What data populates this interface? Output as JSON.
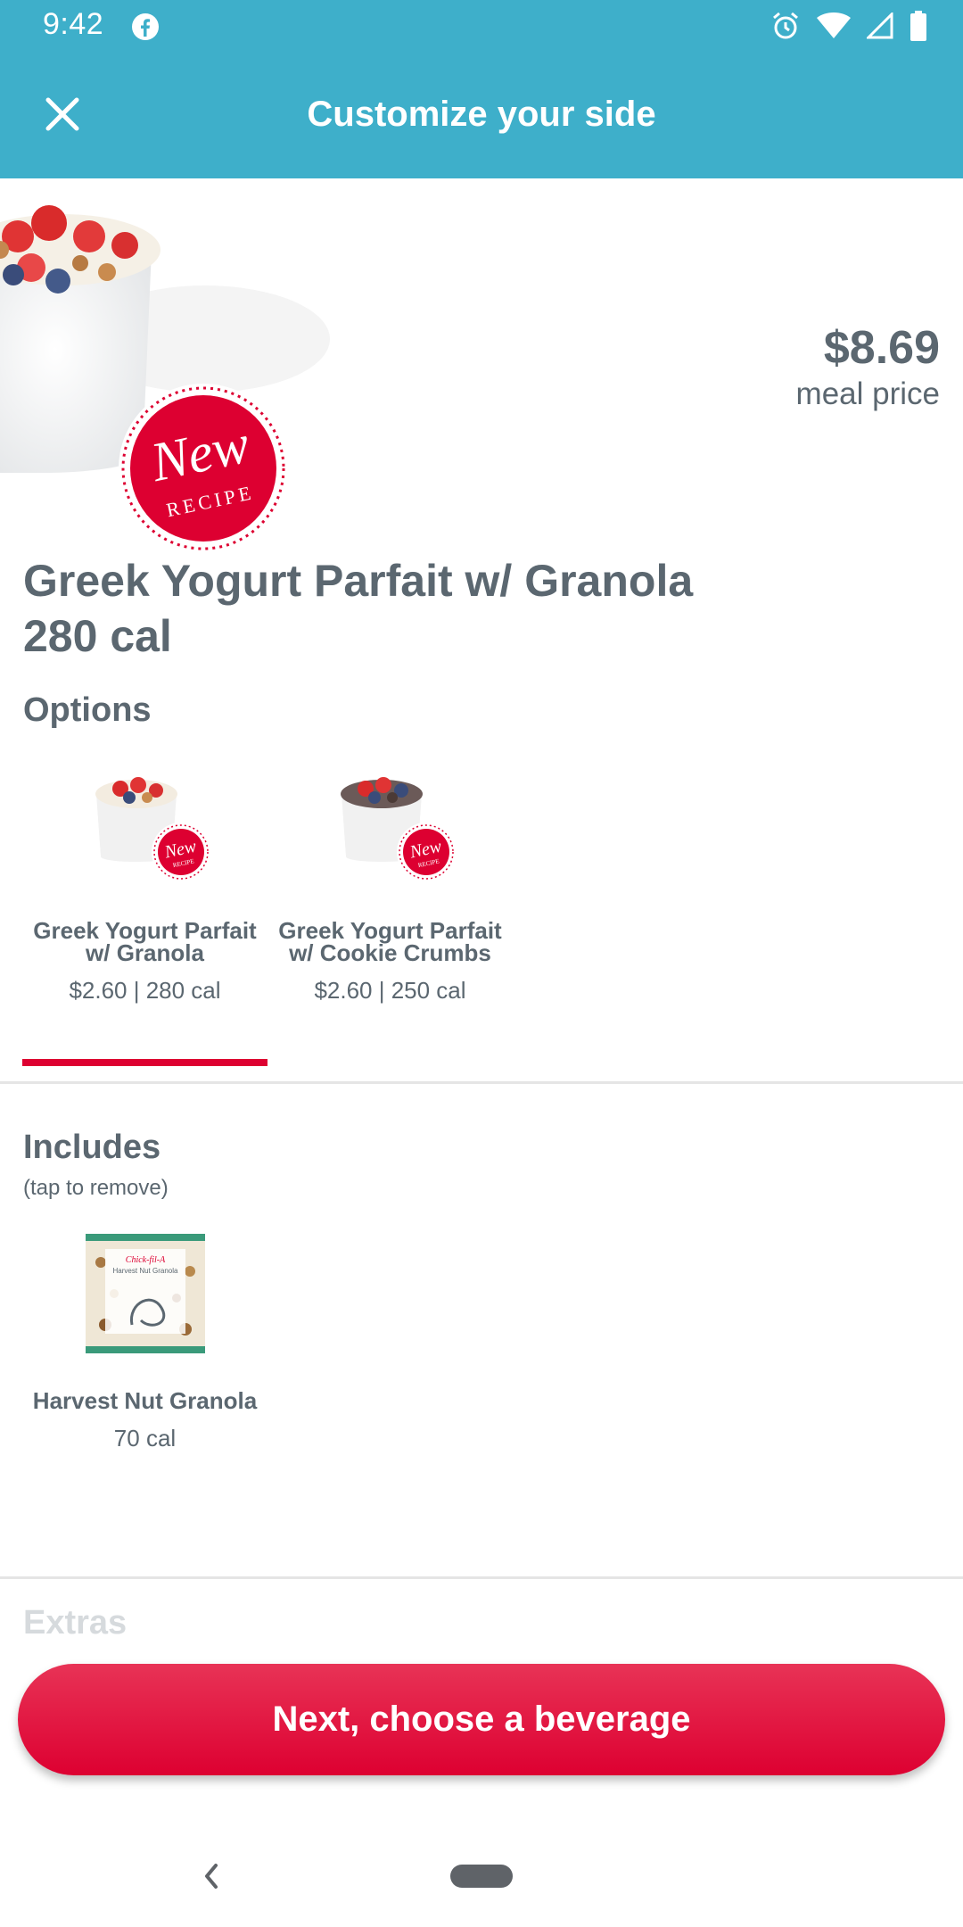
{
  "status_bar": {
    "time": "9:42",
    "icons": [
      "facebook-icon",
      "alarm-icon",
      "wifi-icon",
      "signal-icon",
      "battery-icon"
    ]
  },
  "app_bar": {
    "title": "Customize your side",
    "close_icon": "close-icon"
  },
  "hero": {
    "price": "$8.69",
    "price_label": "meal price",
    "badge_line1": "New",
    "badge_line2": "RECIPE"
  },
  "item": {
    "name": "Greek Yogurt Parfait w/ Granola",
    "calories": "280 cal"
  },
  "options": {
    "label": "Options",
    "items": [
      {
        "name": "Greek Yogurt Parfait w/ Granola",
        "meta": "$2.60 | 280 cal",
        "selected": true
      },
      {
        "name": "Greek Yogurt Parfait w/ Cookie Crumbs",
        "meta": "$2.60 | 250 cal",
        "selected": false
      }
    ]
  },
  "includes": {
    "label": "Includes",
    "hint": "(tap to remove)",
    "items": [
      {
        "name": "Harvest Nut Granola",
        "meta": "70 cal",
        "package_brand": "Chick-fil-A",
        "package_text": "Harvest Nut Granola"
      }
    ]
  },
  "extras": {
    "label": "Extras"
  },
  "cta": {
    "label": "Next, choose a beverage"
  },
  "colors": {
    "brand_teal": "#3eafca",
    "brand_red": "#dd0031",
    "text_gray": "#5b6770"
  }
}
